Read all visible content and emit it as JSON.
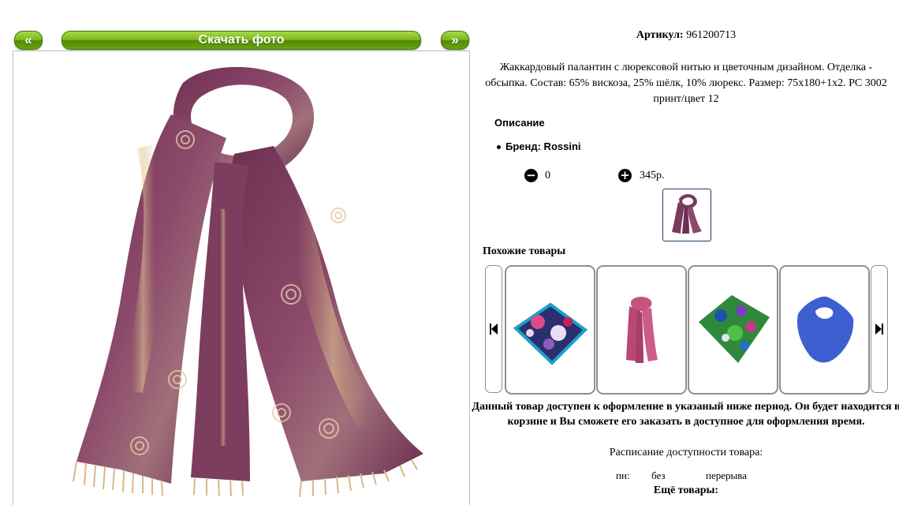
{
  "gallery": {
    "prev_label": "«",
    "download_label": "Скачать фото",
    "next_label": "»"
  },
  "product": {
    "article_label": "Артикул:",
    "article_value": "961200713",
    "description": "Жаккардовый палантин с люрексовой нитью и цветочным дизайном. Отделка - обсыпка. Состав: 65% вискоза, 25% шёлк, 10% люрекс. Размер: 75x180+1x2. PC 3002 принт/цвет 12",
    "section_heading": "Описание",
    "brand_line": "Бренд: Rossini",
    "quantity": "0",
    "price": "345р."
  },
  "similar": {
    "heading": "Похожие товары"
  },
  "availability": {
    "notice": "Данный товар доступен к оформление в указаный ниже период. Он будет находится в корзине и Вы сможете его заказать в доступное для оформления время.",
    "schedule_heading": "Расписание доступности товара:",
    "day": "пн:",
    "time_1": "без",
    "time_2": "перерыва",
    "more_heading": "Ещё товары:"
  },
  "colors": {
    "button_green": "#6aa410",
    "scarf_main": "#7a3b5b",
    "thumb_border": "#1f3f66"
  },
  "icons": {
    "minus": "minus-circle-icon",
    "plus": "plus-circle-icon",
    "carousel_prev": "skip-previous-icon",
    "carousel_next": "skip-next-icon"
  }
}
